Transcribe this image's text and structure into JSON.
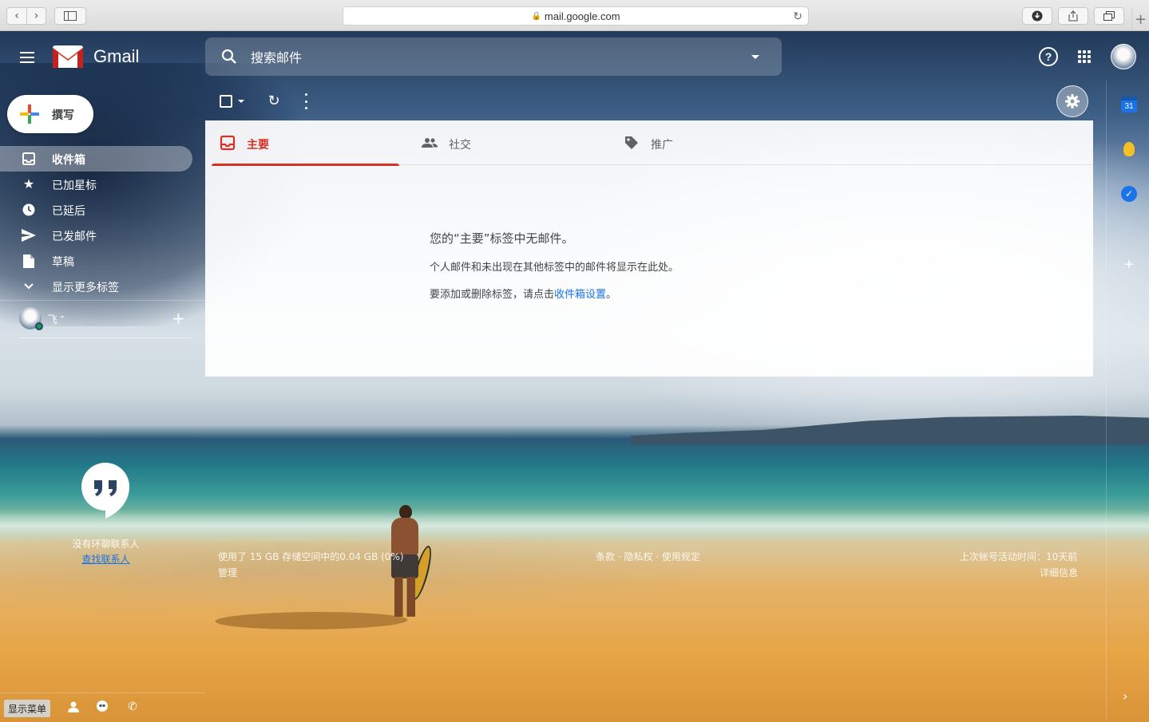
{
  "browser": {
    "url": "mail.google.com"
  },
  "app": {
    "name": "Gmail"
  },
  "search": {
    "placeholder": "搜索邮件"
  },
  "compose": {
    "label": "撰写"
  },
  "nav": {
    "items": [
      {
        "label": "收件箱",
        "icon": "inbox-icon",
        "active": true
      },
      {
        "label": "已加星标",
        "icon": "star-icon",
        "active": false
      },
      {
        "label": "已延后",
        "icon": "clock-icon",
        "active": false
      },
      {
        "label": "已发邮件",
        "icon": "send-icon",
        "active": false
      },
      {
        "label": "草稿",
        "icon": "draft-icon",
        "active": false
      },
      {
        "label": "显示更多标签",
        "icon": "chevron-down-icon",
        "active": false
      }
    ]
  },
  "hangouts": {
    "user_name": "飞",
    "no_contacts": "没有环聊联系人",
    "find_contacts": "查找联系人"
  },
  "bottom_bar": {
    "show_menu": "显示菜单"
  },
  "tabs": [
    {
      "label": "主要",
      "icon": "inbox-tab-icon",
      "active": true
    },
    {
      "label": "社交",
      "icon": "people-icon",
      "active": false
    },
    {
      "label": "推广",
      "icon": "tag-icon",
      "active": false
    }
  ],
  "empty_state": {
    "title": "您的“主要”标签中无邮件。",
    "line1": "个人邮件和未出现在其他标签中的邮件将显示在此处。",
    "line2_prefix": "要添加或删除标签，请点击",
    "line2_link": "收件箱设置",
    "line2_suffix": "。"
  },
  "footer": {
    "storage": "使用了 15 GB 存储空间中的0.04 GB (0%)",
    "manage": "管理",
    "terms": "条款 · 隐私权 · 使用规定",
    "last_activity": "上次帐号活动时间：10天前",
    "details": "详细信息"
  },
  "side_panel": {
    "calendar_day": "31"
  },
  "colors": {
    "accent_red": "#d93025",
    "link_blue": "#1a73e8"
  }
}
